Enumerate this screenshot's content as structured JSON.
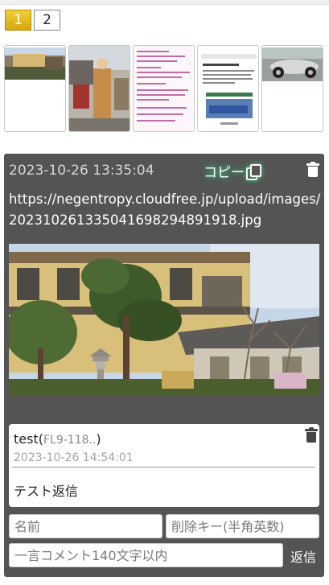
{
  "pagination": {
    "pages": [
      "1",
      "2"
    ],
    "current": "1"
  },
  "thumbnails": [
    {
      "name": "building-photo"
    },
    {
      "name": "person-photo"
    },
    {
      "name": "text-screenshot"
    },
    {
      "name": "webpage-screenshot"
    },
    {
      "name": "car-photo"
    }
  ],
  "post": {
    "datetime": "2023-10-26 13:35:04",
    "copy_label": "コピー",
    "url": "https://negentropy.cloudfree.jp/upload/images/20231026133504169829489​1918.jpg",
    "reply": {
      "name": "test",
      "id": "FL9-118..",
      "datetime": "2023-10-26 14:54:01",
      "body": "テスト返信"
    },
    "form": {
      "name_placeholder": "名前",
      "delete_key_placeholder": "削除キー(半角英数)",
      "comment_placeholder": "一言コメント140文字以内",
      "submit_label": "返信"
    }
  },
  "colors": {
    "accent": "#e0b11c",
    "panel": "#545454",
    "copy_glow": "#3cd48a"
  }
}
